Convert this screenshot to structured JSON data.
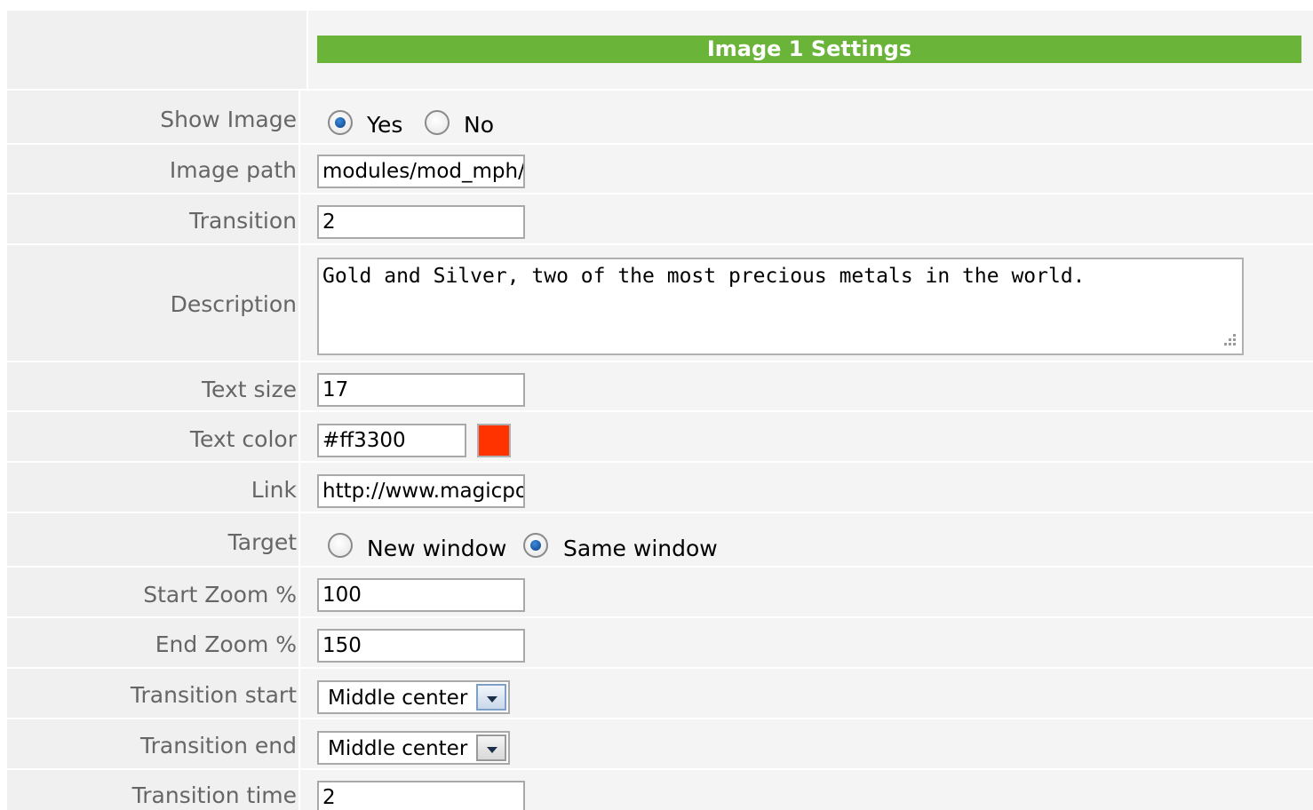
{
  "header": {
    "title": "Image 1 Settings",
    "color": "#6ab43a"
  },
  "fields": {
    "show_image": {
      "label": "Show Image",
      "options": [
        "Yes",
        "No"
      ],
      "selected": "Yes"
    },
    "image_path": {
      "label": "Image path",
      "value": "modules/mod_mph/d"
    },
    "transition": {
      "label": "Transition",
      "value": "2"
    },
    "description": {
      "label": "Description",
      "value": "Gold and Silver, two of the most precious metals in the world."
    },
    "text_size": {
      "label": "Text size",
      "value": "17"
    },
    "text_color": {
      "label": "Text color",
      "value": "#ff3300",
      "swatch": "#ff3300"
    },
    "link": {
      "label": "Link",
      "value": "http://www.magicpoi"
    },
    "target": {
      "label": "Target",
      "options": [
        "New window",
        "Same window"
      ],
      "selected": "Same window"
    },
    "start_zoom": {
      "label": "Start Zoom %",
      "value": "100"
    },
    "end_zoom": {
      "label": "End Zoom %",
      "value": "150"
    },
    "transition_start": {
      "label": "Transition start",
      "value": "Middle center"
    },
    "transition_end": {
      "label": "Transition end",
      "value": "Middle center"
    },
    "transition_time": {
      "label": "Transition time",
      "value": "2"
    }
  }
}
